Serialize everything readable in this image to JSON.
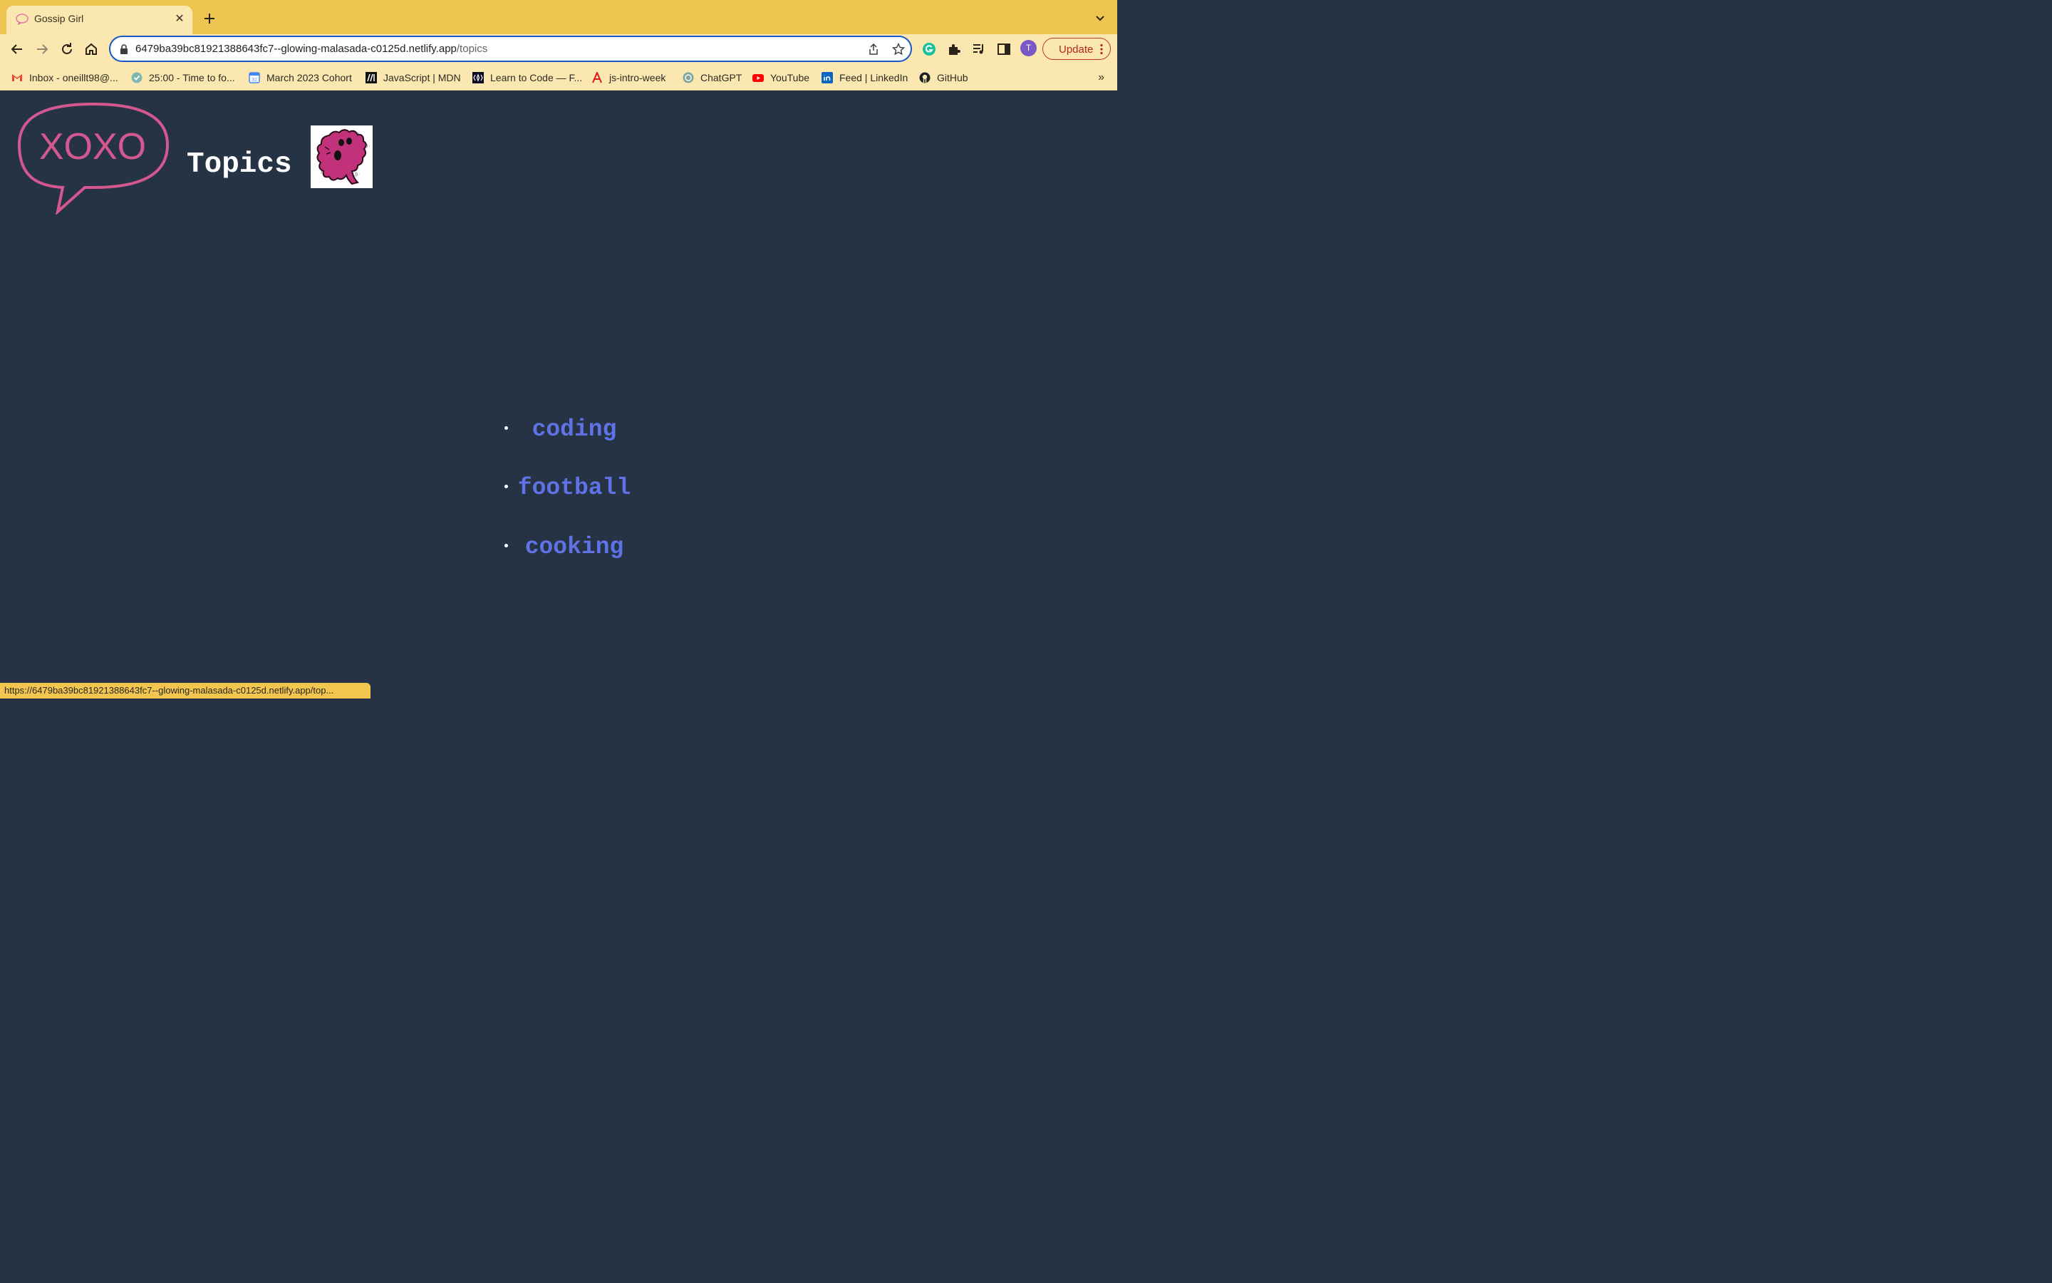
{
  "browser": {
    "tab": {
      "title": "Gossip Girl",
      "favicon": "xoxo-favicon"
    },
    "address": {
      "host": "6479ba39bc81921388643fc7--glowing-malasada-c0125d.netlify.app",
      "path": "/topics"
    },
    "profile_initial": "T",
    "update_label": "Update",
    "bookmarks": [
      {
        "label": "Inbox - oneillt98@...",
        "icon": "gmail-icon"
      },
      {
        "label": "25:00 - Time to fo...",
        "icon": "check-circle-icon"
      },
      {
        "label": "March 2023 Cohort",
        "icon": "calendar-icon"
      },
      {
        "label": "JavaScript | MDN",
        "icon": "mdn-icon"
      },
      {
        "label": "Learn to Code — F...",
        "icon": "freecodecamp-icon"
      },
      {
        "label": "js-intro-week",
        "icon": "angular-icon"
      },
      {
        "label": "ChatGPT",
        "icon": "chatgpt-icon"
      },
      {
        "label": "YouTube",
        "icon": "youtube-icon"
      },
      {
        "label": "Feed | LinkedIn",
        "icon": "linkedin-icon"
      },
      {
        "label": "GitHub",
        "icon": "github-icon"
      }
    ],
    "bookmarks_overflow": "»",
    "status_url": "https://6479ba39bc81921388643fc7--glowing-malasada-c0125d.netlify.app/top..."
  },
  "page": {
    "logo_text": "XOXO",
    "title": "Topics",
    "topics": [
      "coding",
      "football",
      "cooking"
    ]
  },
  "colors": {
    "page_background": "#253345",
    "logo_pink": "#d4588f",
    "topic_link": "#5f72e6",
    "chrome_yellow": "#efc552"
  }
}
